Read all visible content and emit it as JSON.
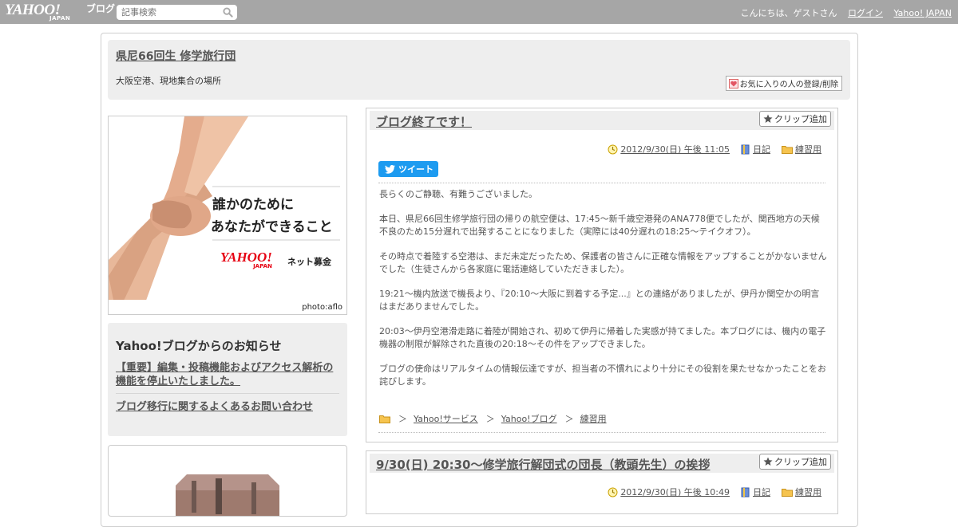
{
  "topbar": {
    "logo_main": "YAHOO!",
    "logo_sub": "JAPAN",
    "logo_blog": "ブログ",
    "search_placeholder": "記事検索",
    "greeting": "こんにちは、ゲストさん",
    "login": "ログイン",
    "yahoo_japan": "Yahoo! JAPAN"
  },
  "header": {
    "title": "県尼66回生 修学旅行団",
    "description": "大阪空港、現地集合の場所",
    "favorite_button": "お気に入りの人の登録/削除"
  },
  "banner": {
    "line1": "誰かのために",
    "line2": "あなたができること",
    "brand": "YAHOO!",
    "brand_sub": "JAPAN",
    "service": "ネット募金",
    "credit": "photo:aflo"
  },
  "notice": {
    "heading": "Yahoo!ブログからのお知らせ",
    "items": [
      "【重要】編集・投稿機能およびアクセス解析の機能を停止いたしました。",
      "ブログ移行に関するよくあるお問い合わせ"
    ]
  },
  "articles": [
    {
      "title": "ブログ終了です！",
      "clip": "クリップ追加",
      "datetime": "2012/9/30(日) 午後 11:05",
      "category": "日記",
      "folder": "練習用",
      "tweet": "ツイート",
      "paragraphs": [
        "長らくのご静聴、有難うございました。",
        "本日、県尼66回生修学旅行団の帰りの航空便は、17:45～新千歳空港発のANA778便でしたが、関西地方の天候不良のため15分遅れで出発することになりました（実際には40分遅れの18:25～テイクオフ）。",
        "その時点で着陸する空港は、まだ未定だったため、保護者の皆さんに正確な情報をアップすることがかないませんでした（生徒さんから各家庭に電話連絡していただきました）。",
        "19:21～機内放送で機長より、『20:10～大阪に到着する予定...』との連絡がありましたが、伊丹か関空かの明言はまだありませんでした。",
        "20:03～伊丹空港滑走路に着陸が開始され、初めて伊丹に帰着した実感が持てました。本ブログには、機内の電子機器の制限が解除された直後の20:18～その件をアップできました。",
        "ブログの使命はリアルタイムの情報伝達ですが、担当者の不慣れにより十分にその役割を果たせなかったことをお詫びします。"
      ],
      "breadcrumbs": [
        "Yahoo!サービス",
        "Yahoo!ブログ",
        "練習用"
      ],
      "crumb_sep": "＞"
    },
    {
      "title": "9/30(日) 20:30～修学旅行解団式の団長（教頭先生）の挨拶",
      "clip": "クリップ追加",
      "datetime": "2012/9/30(日) 午後 10:49",
      "category": "日記",
      "folder": "練習用"
    }
  ],
  "colors": {
    "topbar_bg": "#a6a6a6",
    "panel_bg": "#eeeeee",
    "tweet_blue": "#1d9bf0"
  }
}
